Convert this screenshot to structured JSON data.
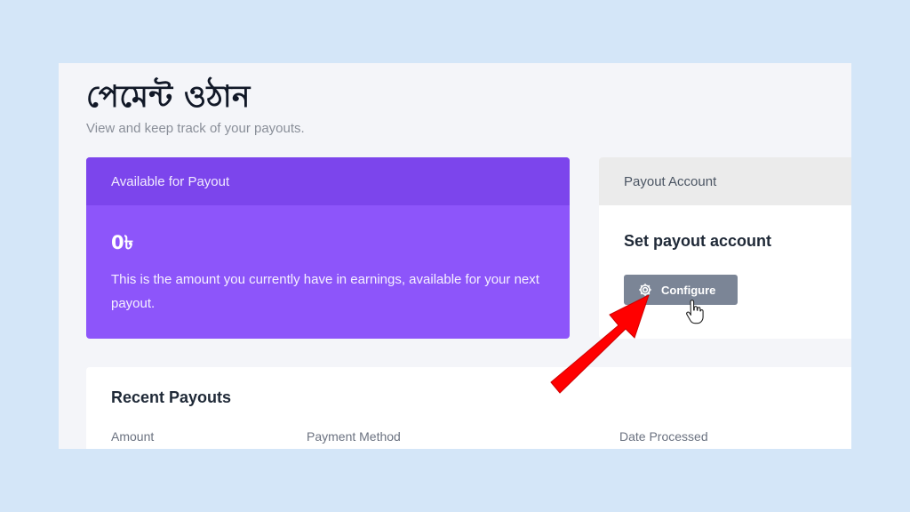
{
  "page": {
    "title": "পেমেন্ট ওঠান",
    "subtitle": "View and keep track of your payouts."
  },
  "payout_card": {
    "header": "Available for Payout",
    "amount": "0৳",
    "description": "This is the amount you currently have in earnings, available for your next payout.",
    "color": "#8d55fa"
  },
  "account_card": {
    "header": "Payout Account",
    "title": "Set payout account",
    "button_label": "Configure",
    "button_icon": "gear-icon"
  },
  "recent_payouts": {
    "title": "Recent Payouts",
    "columns": [
      "Amount",
      "Payment Method",
      "Date Processed"
    ]
  },
  "annotations": {
    "arrow_color": "#ff0000",
    "cursor": "hand-pointer-icon"
  }
}
